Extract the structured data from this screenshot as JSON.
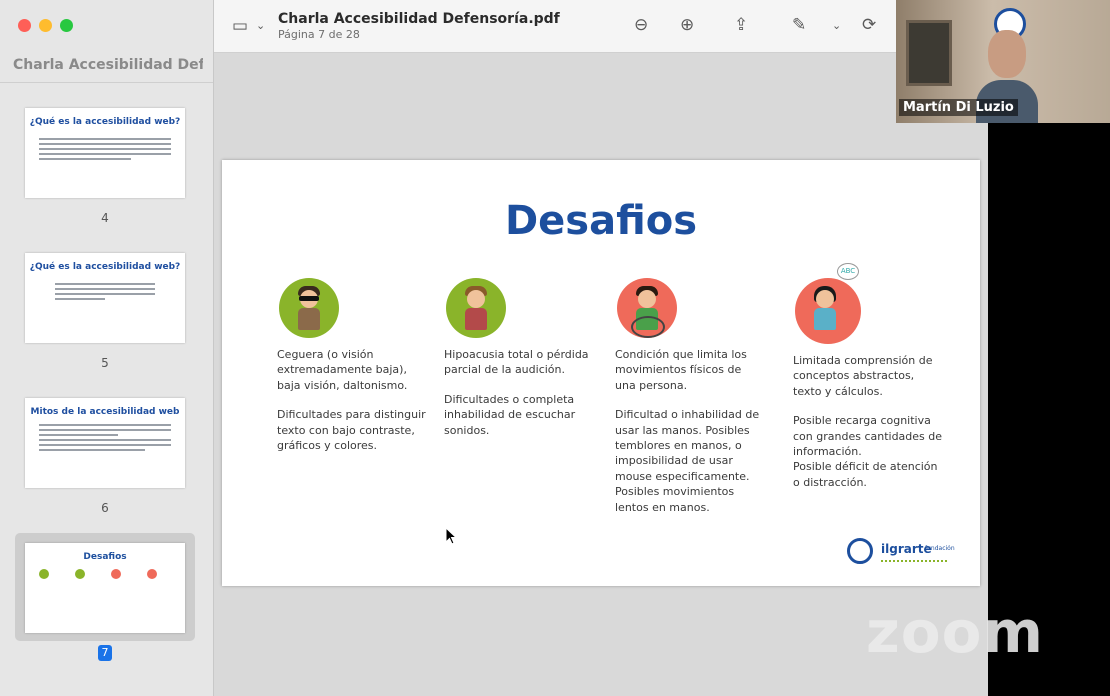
{
  "window": {
    "sidebar_title": "Charla Accesibilidad Defen..."
  },
  "toolbar": {
    "title": "Charla Accesibilidad Defensoría.pdf",
    "subtitle": "Página 7 de 28"
  },
  "thumbnails": [
    {
      "heading": "¿Qué es la accesibilidad web?",
      "page": "4"
    },
    {
      "heading": "¿Qué es la accesibilidad web?",
      "page": "5"
    },
    {
      "heading": "Mitos de la accesibilidad web",
      "page": "6"
    },
    {
      "heading": "Desafios",
      "page": "7"
    }
  ],
  "slide": {
    "title": "Desafios",
    "bubble": "ABC",
    "columns": [
      {
        "p1": "Ceguera (o visión extremadamente baja), baja visión, daltonismo.",
        "p2": "Dificultades para distinguir texto con bajo contraste, gráficos y colores.",
        "color": "#8ab42a"
      },
      {
        "p1": "Hipoacusia total o pérdida parcial de la audición.",
        "p2": "Dificultades o completa inhabilidad de escuchar sonidos.",
        "color": "#8ab42a"
      },
      {
        "p1": "Condición que limita los movimientos físicos de una persona.",
        "p2": "Dificultad o inhabilidad de usar las manos. Posibles temblores en manos, o imposibilidad de usar mouse especificamente. Posibles movimientos lentos en manos.",
        "color": "#ef6a5a"
      },
      {
        "p1": "Limitada comprensión de conceptos abstractos, texto y cálculos.",
        "p2": "Posible recarga cognitiva con grandes cantidades de información.\nPosible déficit de atención o distracción.",
        "color": "#ef6a5a"
      }
    ],
    "logo_text": "ilgrarte",
    "logo_sub": "fundación"
  },
  "video": {
    "participant": "Martín Di Luzio"
  },
  "zoom_watermark": "zoom",
  "colors": {
    "accent": "#1d4f9e",
    "page_badge": "#1a73e8"
  }
}
